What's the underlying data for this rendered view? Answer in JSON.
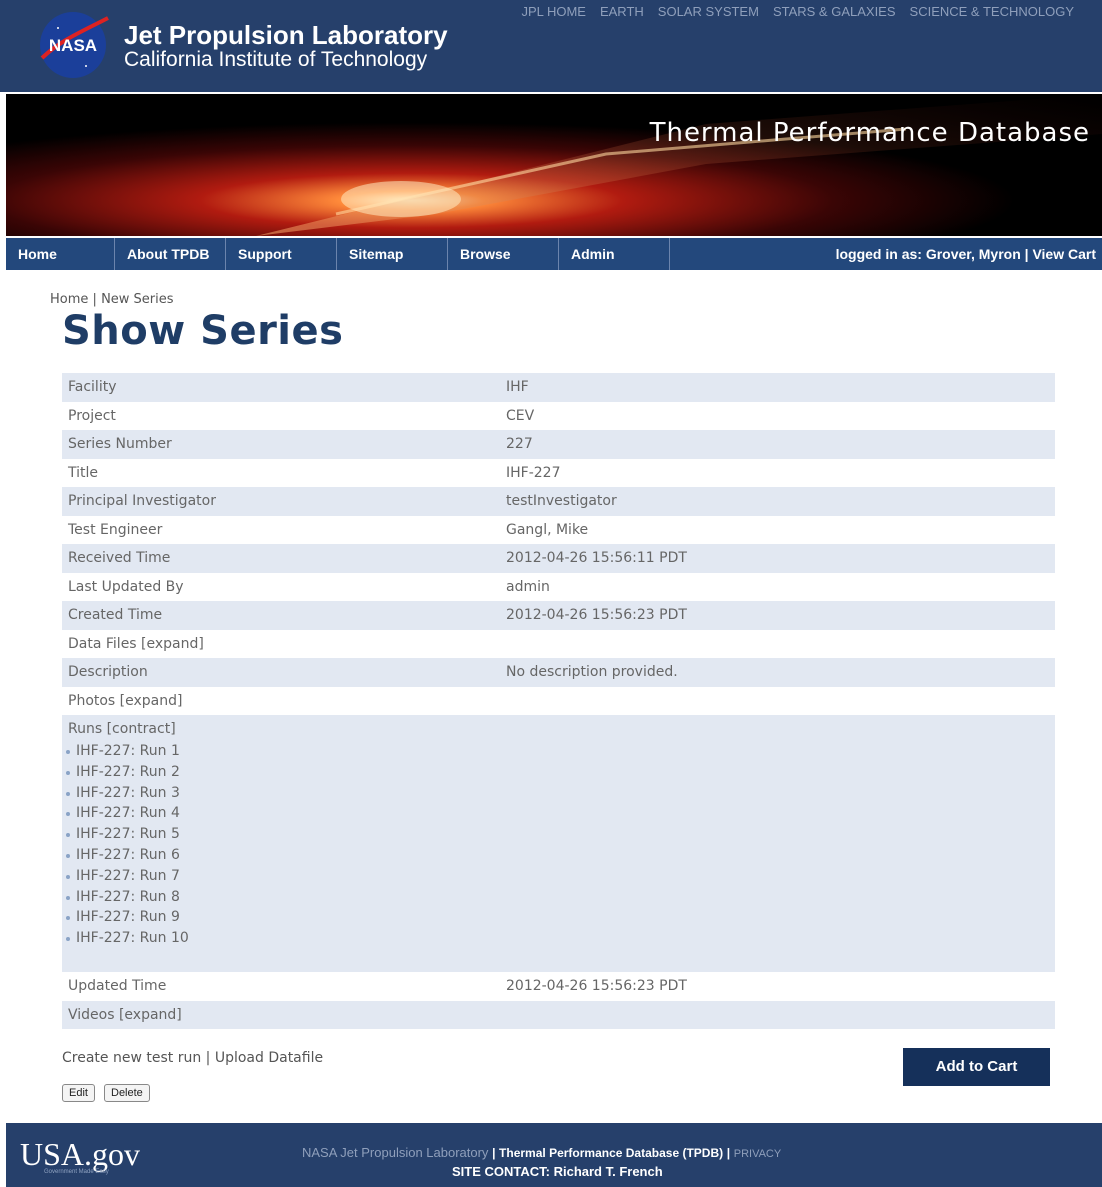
{
  "header": {
    "logo_text": "NASA",
    "title": "Jet Propulsion Laboratory",
    "subtitle": "California Institute of Technology",
    "top_links": [
      "JPL HOME",
      "EARTH",
      "SOLAR SYSTEM",
      "STARS & GALAXIES",
      "SCIENCE & TECHNOLOGY"
    ]
  },
  "banner": {
    "title": "Thermal Performance Database"
  },
  "nav": {
    "items": [
      "Home",
      "About TPDB",
      "Support",
      "Sitemap",
      "Browse",
      "Admin"
    ],
    "login_prefix": "logged in as:",
    "login_user": "Grover, Myron",
    "separator": "|",
    "view_cart": "View Cart"
  },
  "breadcrumb": {
    "home": "Home",
    "sep": "|",
    "current": "New Series"
  },
  "page": {
    "title": "Show Series"
  },
  "series": {
    "rows_top": [
      {
        "label": "Facility",
        "value": "IHF"
      },
      {
        "label": "Project",
        "value": "CEV"
      },
      {
        "label": "Series Number",
        "value": "227"
      },
      {
        "label": "Title",
        "value": "IHF-227"
      },
      {
        "label": "Principal Investigator",
        "value": "testInvestigator"
      },
      {
        "label": "Test Engineer",
        "value": "Gangl, Mike"
      },
      {
        "label": "Received Time",
        "value": "2012-04-26 15:56:11 PDT"
      },
      {
        "label": "Last Updated By",
        "value": "admin"
      },
      {
        "label": "Created Time",
        "value": "2012-04-26 15:56:23 PDT"
      },
      {
        "label": "Data Files [expand]",
        "value": ""
      },
      {
        "label": "Description",
        "value": "No description provided."
      },
      {
        "label": "Photos [expand]",
        "value": ""
      }
    ],
    "runs_label": "Runs [contract]",
    "runs": [
      "IHF-227: Run 1",
      "IHF-227: Run 2",
      "IHF-227: Run 3",
      "IHF-227: Run 4",
      "IHF-227: Run 5",
      "IHF-227: Run 6",
      "IHF-227: Run 7",
      "IHF-227: Run 8",
      "IHF-227: Run 9",
      "IHF-227: Run 10"
    ],
    "rows_bottom": [
      {
        "label": "Updated Time",
        "value": "2012-04-26 15:56:23 PDT"
      },
      {
        "label": "Videos [expand]",
        "value": ""
      }
    ]
  },
  "actions": {
    "create_run": "Create new test run",
    "sep": "|",
    "upload": "Upload Datafile",
    "edit": "Edit",
    "delete": "Delete",
    "add_to_cart": "Add to Cart"
  },
  "footer": {
    "usa_logo": "USA.gov",
    "usa_tagline": "Government Made Easy",
    "org": "NASA Jet Propulsion Laboratory",
    "sep": "|",
    "db_name": "Thermal Performance Database (TPDB)",
    "privacy": "PRIVACY",
    "contact": "SITE CONTACT: Richard T. French"
  }
}
